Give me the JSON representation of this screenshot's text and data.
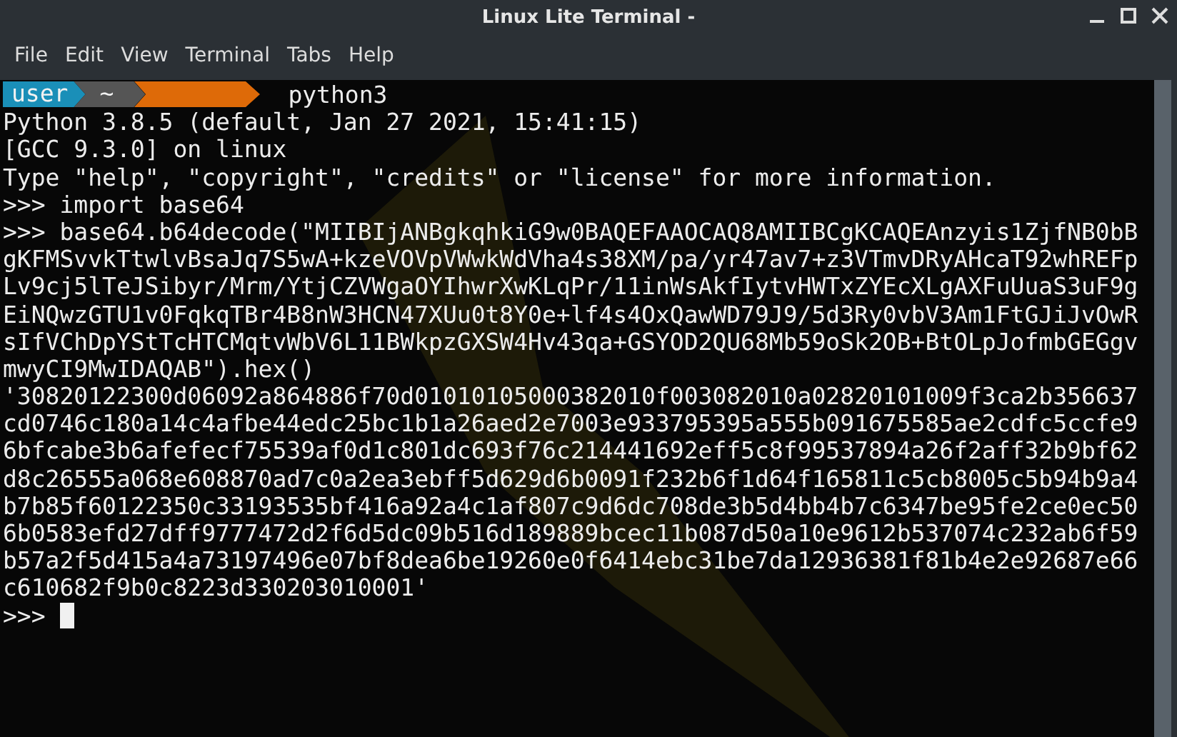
{
  "window": {
    "title": "Linux Lite Terminal -"
  },
  "menu": [
    "File",
    "Edit",
    "View",
    "Terminal",
    "Tabs",
    "Help"
  ],
  "prompt": {
    "user": "user",
    "directory": "~",
    "command": "python3"
  },
  "lines": [
    "Python 3.8.5 (default, Jan 27 2021, 15:41:15)",
    "[GCC 9.3.0] on linux",
    "Type \"help\", \"copyright\", \"credits\" or \"license\" for more information.",
    ">>> import base64",
    ">>> base64.b64decode(\"MIIBIjANBgkqhkiG9w0BAQEFAAOCAQ8AMIIBCgKCAQEAnzyis1ZjfNB0bB",
    "gKFMSvvkTtwlvBsaJq7S5wA+kzeVOVpVWwkWdVha4s38XM/pa/yr47av7+z3VTmvDRyAHcaT92whREFp",
    "Lv9cj5lTeJSibyr/Mrm/YtjCZVWgaOYIhwrXwKLqPr/11inWsAkfIytvHWTxZYEcXLgAXFuUuaS3uF9g",
    "EiNQwzGTU1v0FqkqTBr4B8nW3HCN47XUu0t8Y0e+lf4s4OxQawWD79J9/5d3Ry0vbV3Am1FtGJiJvOwR",
    "sIfVChDpYStTcHTCMqtvWbV6L11BWkpzGXSW4Hv43qa+GSYOD2QU68Mb59oSk2OB+BtOLpJofmbGEGgv",
    "mwyCI9MwIDAQAB\").hex()",
    "'30820122300d06092a864886f70d01010105000382010f003082010a02820101009f3ca2b356637",
    "cd0746c180a14c4afbe44edc25bc1b1a26aed2e7003e933795395a555b091675585ae2cdfc5ccfe9",
    "6bfcabe3b6afefecf75539af0d1c801dc693f76c214441692eff5c8f99537894a26f2aff32b9bf62",
    "d8c26555a068e608870ad7c0a2ea3ebff5d629d6b0091f232b6f1d64f165811c5cb8005c5b94b9a4",
    "b7b85f60122350c33193535bf416a92a4c1af807c9d6dc708de3b5d4bb4b7c6347be95fe2ce0ec50",
    "6b0583efd27dff9777472d2f6d5dc09b516d189889bcec11b087d50a10e9612b537074c232ab6f59",
    "b57a2f5d415a4a73197496e07bf8dea6be19260e0f6414ebc31be7da12936381f81b4e2e92687e66",
    "c610682f9b0c8223d330203010001'"
  ],
  "input_prompt": ">>>"
}
